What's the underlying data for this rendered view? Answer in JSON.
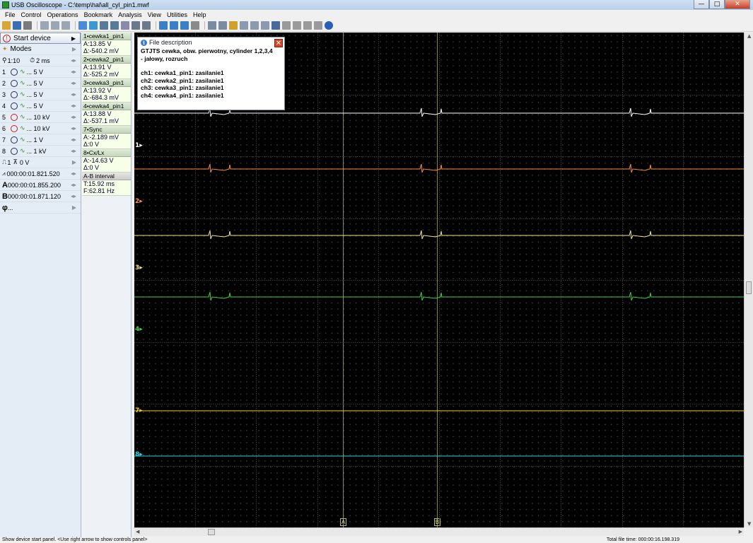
{
  "window": {
    "title": "USB Oscilloscope - C:\\temp\\hal\\all_cyl_pin1.mwf",
    "buttons": {
      "minimize": "—",
      "maximize": "□",
      "close": "✕"
    }
  },
  "menu": [
    "File",
    "Control",
    "Operations",
    "Bookmark",
    "Analysis",
    "View",
    "Utilities",
    "Help"
  ],
  "left_panel": {
    "start_device": "Start device",
    "modes": "Modes",
    "zoom": "1:10",
    "timebase": "2 ms",
    "channels": [
      {
        "num": "1",
        "scale": "... 5 V",
        "color": "#ffffff"
      },
      {
        "num": "2",
        "scale": "... 5 V",
        "color": "#ff8c3a"
      },
      {
        "num": "3",
        "scale": "... 5 V",
        "color": "#f0e68c"
      },
      {
        "num": "4",
        "scale": "... 5 V",
        "color": "#40d040"
      },
      {
        "num": "5",
        "scale": "... 10 kV",
        "color": "#d04040"
      },
      {
        "num": "6",
        "scale": "... 10 kV",
        "color": "#d04040"
      },
      {
        "num": "7",
        "scale": "... 1 V",
        "color": "#f0d020"
      },
      {
        "num": "8",
        "scale": "... 1 kV",
        "color": "#30d0e0"
      }
    ],
    "trigger": "0 V",
    "trigger_ch": "1",
    "timestamp": "000:00:01.821.520",
    "cursor_a_label": "A",
    "cursor_a": "000:00:01.855.200",
    "cursor_b_label": "B",
    "cursor_b": "000:00:01.871.120",
    "phi_label": "φ",
    "phi": "..."
  },
  "info_column": [
    {
      "head": "1•cewka1_pin1",
      "a": "A:13.85 V",
      "d": "Δ:-540.2 mV"
    },
    {
      "head": "2•cewka2_pin1",
      "a": "A:13.91 V",
      "d": "Δ:-525.2 mV"
    },
    {
      "head": "3•cewka3_pin1",
      "a": "A:13.92 V",
      "d": "Δ:-684.3 mV"
    },
    {
      "head": "4•cewka4_pin1",
      "a": "A:13.88 V",
      "d": "Δ:-537.1 mV"
    },
    {
      "head": "7•Sync",
      "a": "A:-2.189 mV",
      "d": "Δ:0 V"
    },
    {
      "head": "8•Cx/Lx",
      "a": "A:-14.63 V",
      "d": "Δ:0 V"
    },
    {
      "head": "A-B interval",
      "a": "T:15.92 ms",
      "d": "F:62.81 Hz"
    }
  ],
  "popup": {
    "title": "File description",
    "close": "✕",
    "line1": "GTJTS cewka, obw. pierwotny, cylinder 1,2,3,4",
    "line2": "- jałowy, rozruch",
    "ch1": "ch1: cewka1_pin1: zasilanie1",
    "ch2": "ch2: cewka2_pin1: zasilanie1",
    "ch3": "ch3: cewka3_pin1: zasilanie1",
    "ch4": "ch4: cewka4_pin1: zasilanie1"
  },
  "scope": {
    "markers": [
      {
        "label": "1▸",
        "color": "#ffffff"
      },
      {
        "label": "2▸",
        "color": "#ff8c3a"
      },
      {
        "label": "3▸",
        "color": "#f0e68c"
      },
      {
        "label": "4▸",
        "color": "#40d040"
      },
      {
        "label": "7▸",
        "color": "#f0d020"
      },
      {
        "label": "8▸",
        "color": "#30d0e0"
      }
    ],
    "cursor_a_tag": "A",
    "cursor_b_tag": "B"
  },
  "status": {
    "left": "Show device start panel. <Use right arrow to show controls panel>",
    "right": "Total file time: 000:00:16.198.319"
  }
}
